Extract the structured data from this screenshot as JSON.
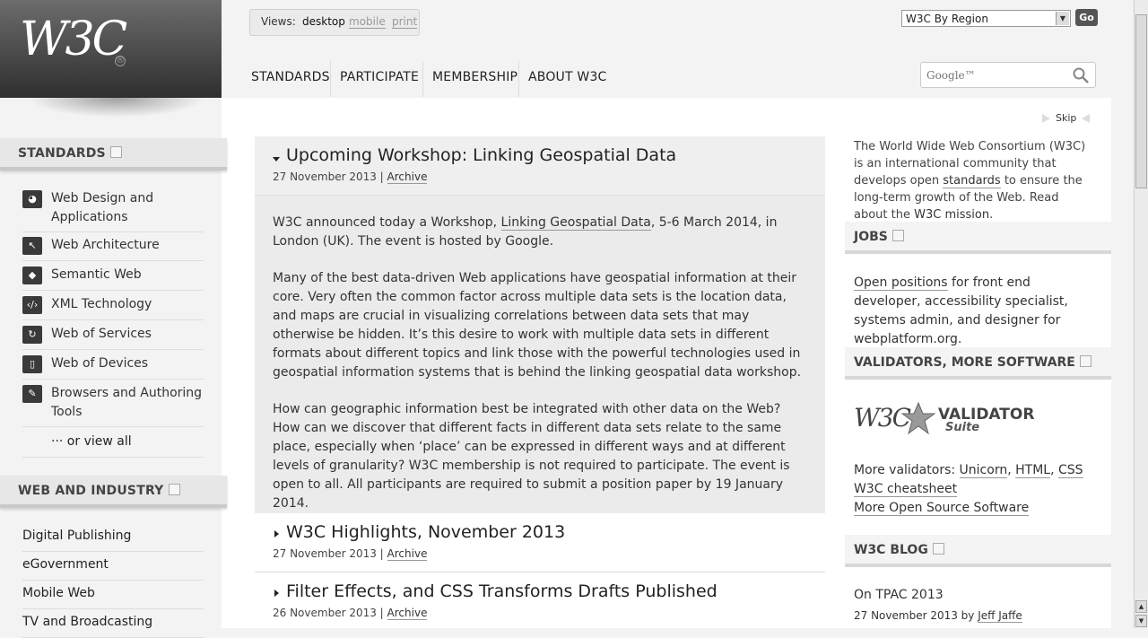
{
  "header": {
    "logo_text": "W3C",
    "views": {
      "label": "Views:",
      "desktop": "desktop",
      "mobile": "mobile",
      "print": "print"
    },
    "region_select": "W3C By Region",
    "go_label": "Go",
    "search_placeholder": "Google™",
    "topnav": [
      "STANDARDS",
      "PARTICIPATE",
      "MEMBERSHIP",
      "ABOUT W3C"
    ]
  },
  "sidebar": {
    "standards_title": "STANDARDS",
    "standards_items": [
      {
        "label_line1": "Web Design and",
        "label_line2": "Applications",
        "icon": "design-icon"
      },
      {
        "label_line1": "Web Architecture",
        "icon": "architecture-icon"
      },
      {
        "label_line1": "Semantic Web",
        "icon": "semantic-icon"
      },
      {
        "label_line1": "XML Technology",
        "icon": "xml-icon"
      },
      {
        "label_line1": "Web of Services",
        "icon": "services-icon"
      },
      {
        "label_line1": "Web of Devices",
        "icon": "devices-icon"
      },
      {
        "label_line1": "Browsers and Authoring",
        "label_line2": "Tools",
        "icon": "browsers-icon"
      }
    ],
    "view_all": "··· or view all",
    "industry_title": "WEB AND INDUSTRY",
    "industry_items": [
      "Digital Publishing",
      "eGovernment",
      "Mobile Web",
      "TV and Broadcasting"
    ]
  },
  "news": {
    "skip": "Skip",
    "feature": {
      "title": "Upcoming Workshop: Linking Geospatial Data",
      "date": "27 November 2013 | ",
      "archive": "Archive",
      "p1_a": "W3C announced today a Workshop, ",
      "p1_link": "Linking Geospatial Data",
      "p1_b": ", 5-6 March 2014, in London (UK). The event is hosted by Google.",
      "p2": "Many of the best data-driven Web applications have geospatial information at their core. Very often the common factor across multiple data sets is the location data, and maps are crucial in visualizing correlations between data sets that may otherwise be hidden. It’s this desire to work with multiple data sets in different formats about different topics and link those with the powerful technologies used in geospatial information systems that is behind the linking geospatial data workshop.",
      "p3": "How can geographic information best be integrated with other data on the Web? How can we discover that different facts in different data sets relate to the same place, especially when ‘place’ can be expressed in different ways and at different levels of granularity? W3C membership is not required to participate. The event is open to all. All participants are required to submit a position paper by 19 January 2014."
    },
    "articles": [
      {
        "title": "W3C Highlights, November 2013",
        "date": "27 November 2013 | ",
        "archive": "Archive"
      },
      {
        "title": "Filter Effects, and CSS Transforms Drafts Published",
        "date": "26 November 2013 | ",
        "archive": "Archive"
      }
    ]
  },
  "right": {
    "intro_a": "The World Wide Web Consortium (W3C) is an international community that develops open ",
    "intro_link1": "standards",
    "intro_b": " to ensure the long-term growth of the Web. Read about the ",
    "intro_link2": "W3C mission",
    "intro_c": ".",
    "jobs_title": "JOBS",
    "jobs_link": "Open positions",
    "jobs_text": " for front end developer, accessibility specialist, systems admin, and designer for webplatform.org.",
    "validators_title": "VALIDATORS, MORE SOFTWARE",
    "validator_logo": "VALIDATOR",
    "validator_suite": "Suite",
    "more_validators": "More validators: ",
    "v_unicorn": "Unicorn",
    "v_html": "HTML",
    "v_css": "CSS",
    "cheatsheet": "W3C cheatsheet",
    "open_source": "More Open Source Software",
    "blog_title": "W3C BLOG",
    "blog_post": "On TPAC 2013",
    "blog_date": "27 November 2013 by ",
    "blog_author": "Jeff Jaffe"
  }
}
